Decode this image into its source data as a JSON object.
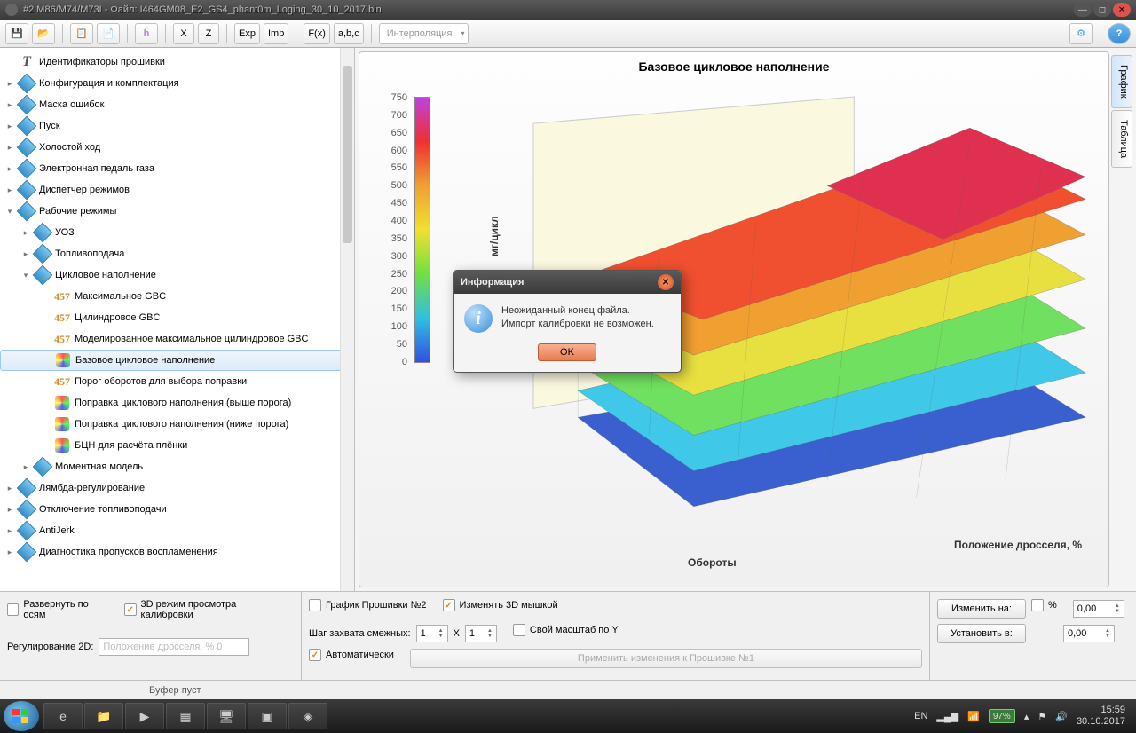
{
  "window": {
    "title": "#2 M86/M74/M73I - Файл: I464GM08_E2_GS4_phant0m_Loging_30_10_2017.bin"
  },
  "toolbar": {
    "save": "💾",
    "open": "📂",
    "x": "X",
    "z": "Z",
    "exp": "Exp",
    "imp": "Imp",
    "fx": "F(x)",
    "abc": "a,b,c",
    "interp": "Интерполяция"
  },
  "tree": [
    {
      "lvl": 0,
      "icon": "T",
      "label": "Идентификаторы прошивки",
      "exp": ""
    },
    {
      "lvl": 0,
      "icon": "D",
      "label": "Конфигурация и комплектация",
      "exp": "+"
    },
    {
      "lvl": 0,
      "icon": "D",
      "label": "Маска ошибок",
      "exp": "+"
    },
    {
      "lvl": 0,
      "icon": "D",
      "label": "Пуск",
      "exp": "+"
    },
    {
      "lvl": 0,
      "icon": "D",
      "label": "Холостой ход",
      "exp": "+"
    },
    {
      "lvl": 0,
      "icon": "D",
      "label": "Электронная педаль газа",
      "exp": "+"
    },
    {
      "lvl": 0,
      "icon": "D",
      "label": "Диспетчер режимов",
      "exp": "+"
    },
    {
      "lvl": 0,
      "icon": "D",
      "label": "Рабочие режимы",
      "exp": "-"
    },
    {
      "lvl": 1,
      "icon": "D",
      "label": "УОЗ",
      "exp": "+"
    },
    {
      "lvl": 1,
      "icon": "D",
      "label": "Топливоподача",
      "exp": "+"
    },
    {
      "lvl": 1,
      "icon": "D",
      "label": "Цикловое наполнение",
      "exp": "-"
    },
    {
      "lvl": 2,
      "icon": "457",
      "label": "Максимальное GBC",
      "exp": ""
    },
    {
      "lvl": 2,
      "icon": "457",
      "label": "Цилиндровое GBC",
      "exp": ""
    },
    {
      "lvl": 2,
      "icon": "457",
      "label": "Моделированное максимальное цилиндровое GBC",
      "exp": ""
    },
    {
      "lvl": 2,
      "icon": "C",
      "label": "Базовое цикловое наполнение",
      "exp": "",
      "sel": true
    },
    {
      "lvl": 2,
      "icon": "457",
      "label": "Порог оборотов для выбора поправки",
      "exp": ""
    },
    {
      "lvl": 2,
      "icon": "C",
      "label": "Поправка циклового наполнения (выше порога)",
      "exp": ""
    },
    {
      "lvl": 2,
      "icon": "C",
      "label": "Поправка циклового наполнения (ниже порога)",
      "exp": ""
    },
    {
      "lvl": 2,
      "icon": "C",
      "label": "БЦН для расчёта плёнки",
      "exp": ""
    },
    {
      "lvl": 1,
      "icon": "D",
      "label": "Моментная модель",
      "exp": "+"
    },
    {
      "lvl": 0,
      "icon": "D",
      "label": "Лямбда-регулирование",
      "exp": "+"
    },
    {
      "lvl": 0,
      "icon": "D",
      "label": "Отключение топливоподачи",
      "exp": "+"
    },
    {
      "lvl": 0,
      "icon": "D",
      "label": "AntiJerk",
      "exp": "+"
    },
    {
      "lvl": 0,
      "icon": "D",
      "label": "Диагностика пропусков воспламенения",
      "exp": "+"
    }
  ],
  "graph": {
    "title": "Базовое цикловое наполнение",
    "zlabel": "мг/цикл",
    "xlabel": "Обороты",
    "ylabel": "Положение дросселя, %",
    "colorbar_ticks": [
      "750",
      "700",
      "650",
      "600",
      "550",
      "500",
      "450",
      "400",
      "350",
      "300",
      "250",
      "200",
      "150",
      "100",
      "50",
      "0"
    ]
  },
  "side_tabs": {
    "graph": "График",
    "table": "Таблица"
  },
  "controls": {
    "expand_axes": "Развернуть по осям",
    "mode3d": "3D режим просмотра калибровки",
    "reg2d_label": "Регулирование 2D:",
    "reg2d_ph": "Положение дросселя, % 0",
    "graph2": "График Прошивки №2",
    "mouse3d": "Изменять 3D мышкой",
    "step_label": "Шаг захвата смежных:",
    "step_x": "1",
    "step_sep": "X",
    "step_y": "1",
    "own_scale": "Свой масштаб по Y",
    "auto": "Автоматически",
    "apply": "Применить изменения к Прошивке №1",
    "change_to": "Изменить на:",
    "pct": "%",
    "val1": "0,00",
    "set_to": "Установить в:",
    "val2": "0,00"
  },
  "status": {
    "buffer": "Буфер пуст"
  },
  "dialog": {
    "title": "Информация",
    "line1": "Неожиданный конец файла.",
    "line2": "Импорт калибровки не возможен.",
    "ok": "OK"
  },
  "taskbar": {
    "lang": "EN",
    "battery": "97%",
    "time": "15:59",
    "date": "30.10.2017"
  },
  "chart_data": {
    "type": "surface3d",
    "title": "Базовое цикловое наполнение",
    "xlabel": "Обороты",
    "ylabel": "Положение дросселя, %",
    "zlabel": "мг/цикл",
    "x_range": [
      600,
      7000
    ],
    "y_range": [
      2,
      99.6
    ],
    "z_range": [
      0,
      750
    ],
    "colorbar_range": [
      0,
      750
    ],
    "note": "3D calibration surface; values rise from ~50-100 at low throttle to ~600-700 at high throttle/rpm"
  }
}
